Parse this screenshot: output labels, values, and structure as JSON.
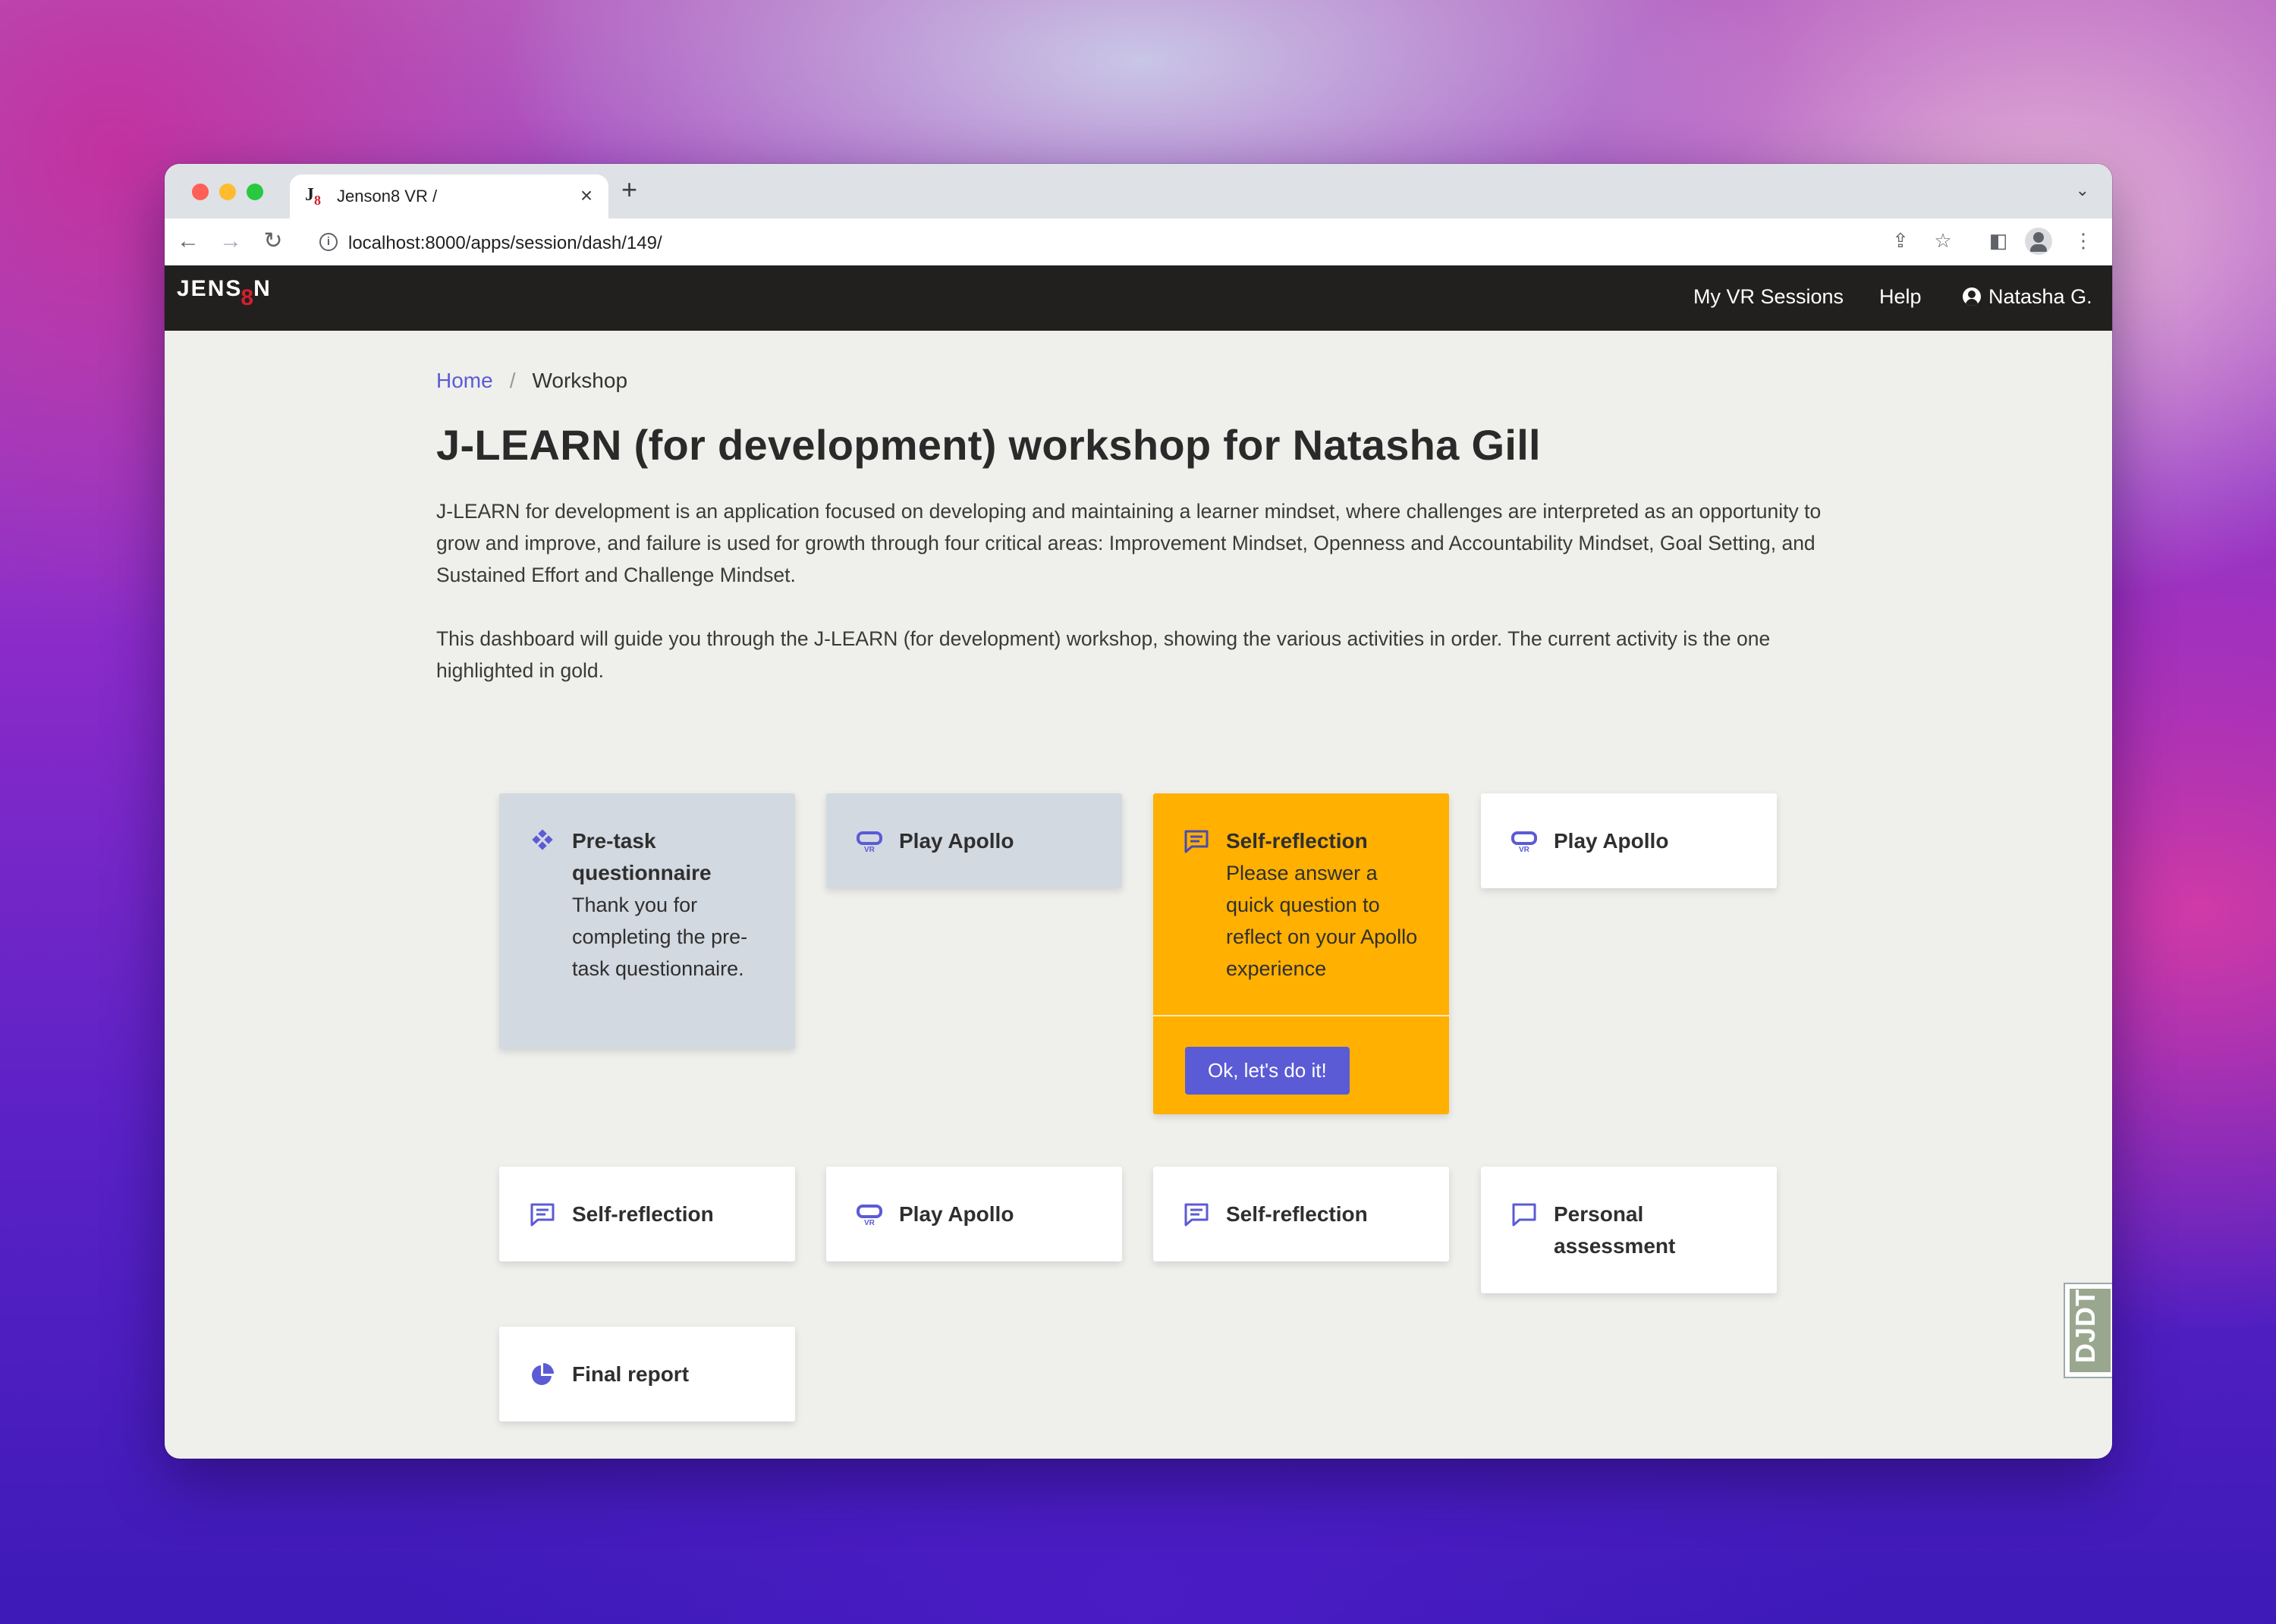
{
  "browser": {
    "tab_title": "Jenson8 VR /",
    "url": "localhost:8000/apps/session/dash/149/"
  },
  "site": {
    "logo_text_left": "JENS",
    "logo_text_eight": "8",
    "logo_text_right": "N",
    "nav": {
      "sessions": "My VR Sessions",
      "help": "Help",
      "user": "Natasha G."
    }
  },
  "breadcrumb": {
    "home": "Home",
    "separator": "/",
    "current": "Workshop"
  },
  "page": {
    "title": "J-LEARN (for development) workshop for Natasha Gill",
    "description_1": "J-LEARN for development is an application focused on developing and maintaining a learner mindset, where challenges are interpreted as an opportunity to grow and improve, and failure is used for growth through four critical areas: Improvement Mindset, Openness and Accountability Mindset, Goal Setting, and Sustained Effort and Challenge Mindset.",
    "description_2": "This dashboard will guide you through the J-LEARN (for development) workshop, showing the various activities in order. The current activity is the one highlighted in gold."
  },
  "activities": [
    {
      "title": "Pre-task questionnaire",
      "text": "Thank you for completing the pre-task questionnaire.",
      "state": "done",
      "icon": "diamonds-icon"
    },
    {
      "title": "Play Apollo",
      "text": "",
      "state": "done",
      "icon": "vr-headset-icon"
    },
    {
      "title": "Self-reflection",
      "text": "Please answer a quick question to reflect on your Apollo experience",
      "state": "current",
      "icon": "chat-lines-icon",
      "button": "Ok, let's do it!"
    },
    {
      "title": "Play Apollo",
      "text": "",
      "state": "pending",
      "icon": "vr-headset-icon"
    },
    {
      "title": "Self-reflection",
      "text": "",
      "state": "pending",
      "icon": "chat-lines-icon"
    },
    {
      "title": "Play Apollo",
      "text": "",
      "state": "pending",
      "icon": "vr-headset-icon"
    },
    {
      "title": "Self-reflection",
      "text": "",
      "state": "pending",
      "icon": "chat-lines-icon"
    },
    {
      "title": "Personal assessment",
      "text": "",
      "state": "pending",
      "icon": "chat-outline-icon"
    },
    {
      "title": "Final report",
      "text": "",
      "state": "pending",
      "icon": "pie-chart-icon"
    }
  ],
  "colors": {
    "accent": "#5b5bd6",
    "current": "#ffb000",
    "done": "#d3d9e1",
    "navbar": "#221f1f"
  },
  "debug_toolbar": {
    "label": "DJDT"
  }
}
